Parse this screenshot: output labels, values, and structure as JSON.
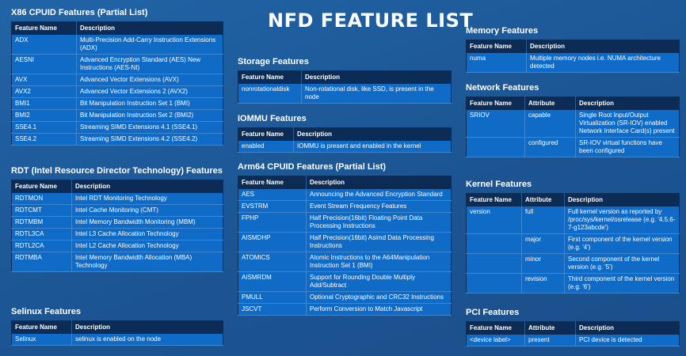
{
  "page_title": "NFD FEATURE LIST",
  "x86": {
    "title": "X86 CPUID Features (Partial List)",
    "headers": [
      "Feature Name",
      "Description"
    ],
    "rows": [
      [
        "ADX",
        "Multi-Precision Add-Carry Instruction Extensions (ADX)"
      ],
      [
        "AESNI",
        "Advanced Encryption Standard (AES) New Instructions (AES-NI)"
      ],
      [
        "AVX",
        "Advanced Vector Extensions (AVX)"
      ],
      [
        "AVX2",
        "Advanced Vector Extensions 2 (AVX2)"
      ],
      [
        "BMI1",
        "Bit Manipulation Instruction Set 1 (BMI)"
      ],
      [
        "BMI2",
        "Bit Manipulation Instruction Set 2 (BMI2)"
      ],
      [
        "SSE4.1",
        "Streaming SIMD Extensions 4.1 (SSE4.1)"
      ],
      [
        "SSE4.2",
        "Streaming SIMD Extensions 4.2 (SSE4.2)"
      ]
    ]
  },
  "rdt": {
    "title": "RDT (Intel Resource Director Technology) Features",
    "headers": [
      "Feature Name",
      "Description"
    ],
    "rows": [
      [
        "RDTMON",
        "Intel RDT Monitoring Technology"
      ],
      [
        "RDTCMT",
        "Intel Cache Monitoring (CMT)"
      ],
      [
        "RDTMBM",
        "Intel Memory Bandwidth Monitoring (MBM)"
      ],
      [
        "RDTL3CA",
        "Intel L3 Cache Allocation Technology"
      ],
      [
        "RDTL2CA",
        "Intel L2 Cache Allocation Technology"
      ],
      [
        "RDTMBA",
        "Intel Memory Bandwidth Allocation (MBA) Technology"
      ]
    ]
  },
  "selinux": {
    "title": "Selinux Features",
    "headers": [
      "Feature Name",
      "Description"
    ],
    "rows": [
      [
        "Selinux",
        "selinux is enabled on the node"
      ]
    ]
  },
  "storage": {
    "title": "Storage Features",
    "headers": [
      "Feature Name",
      "Description"
    ],
    "rows": [
      [
        "nonrotationaldisk",
        "Non-rotational disk, like SSD, is present in the node"
      ]
    ]
  },
  "iommu": {
    "title": "IOMMU Features",
    "headers": [
      "Feature Name",
      "Description"
    ],
    "rows": [
      [
        "enabled",
        "IOMMU is present and enabled in the kernel"
      ]
    ]
  },
  "arm64": {
    "title": "Arm64 CPUID Features (Partial List)",
    "headers": [
      "Feature Name",
      "Description"
    ],
    "rows": [
      [
        "AES",
        "Announcing the Advanced Encryption Standard"
      ],
      [
        "EVSTRM",
        "Event Stream Frequency Features"
      ],
      [
        "FPHP",
        "Half Precision(16bit) Floating Point Data Processing Instructions"
      ],
      [
        "AISMDHP",
        "Half Precision(16bit) Asimd Data Processing Instructions"
      ],
      [
        "ATOMICS",
        "Atomic Instructions to the A64Manipulation Instruction Set 1 (BMI)"
      ],
      [
        "AISMRDM",
        "Support for Rounding Double Multiply Add/Subtract"
      ],
      [
        "PMULL",
        "Optional Cryptographic and CRC32 Instructions"
      ],
      [
        "JSCVT",
        "Perform Conversion to Match Javascript"
      ]
    ]
  },
  "memory": {
    "title": "Memory Features",
    "headers": [
      "Feature Name",
      "Description"
    ],
    "rows": [
      [
        "numa",
        "Multiple memory nodes i.e. NUMA architecture detected"
      ]
    ]
  },
  "network": {
    "title": "Network Features",
    "headers": [
      "Feature Name",
      "Attribute",
      "Description"
    ],
    "rows": [
      [
        "SRIOV",
        "capable",
        "Single Root Input/Output Virtualization (SR-IOV) enabled Network Interface Card(s) present"
      ],
      [
        "",
        "configured",
        "SR-IOV virtual functions have been configured"
      ]
    ]
  },
  "kernel": {
    "title": "Kernel Features",
    "headers": [
      "Feature Name",
      "Attribute",
      "Description"
    ],
    "rows": [
      [
        "version",
        "full",
        "Full kernel version as reported by /proc/sys/kernel/osrelease (e.g. '4.5.6-7-g123abcde')"
      ],
      [
        "",
        "major",
        "First component of the kernel version (e.g. '4')"
      ],
      [
        "",
        "minor",
        "Second component of the kernel version (e.g. '5')"
      ],
      [
        "",
        "revision",
        "Third component of the kernel version (e.g. '6')"
      ]
    ]
  },
  "pci": {
    "title": "PCI Features",
    "headers": [
      "Feature Name",
      "Attribute",
      "Description"
    ],
    "rows": [
      [
        "<device label>",
        "present",
        "PCI device is detected"
      ]
    ]
  }
}
